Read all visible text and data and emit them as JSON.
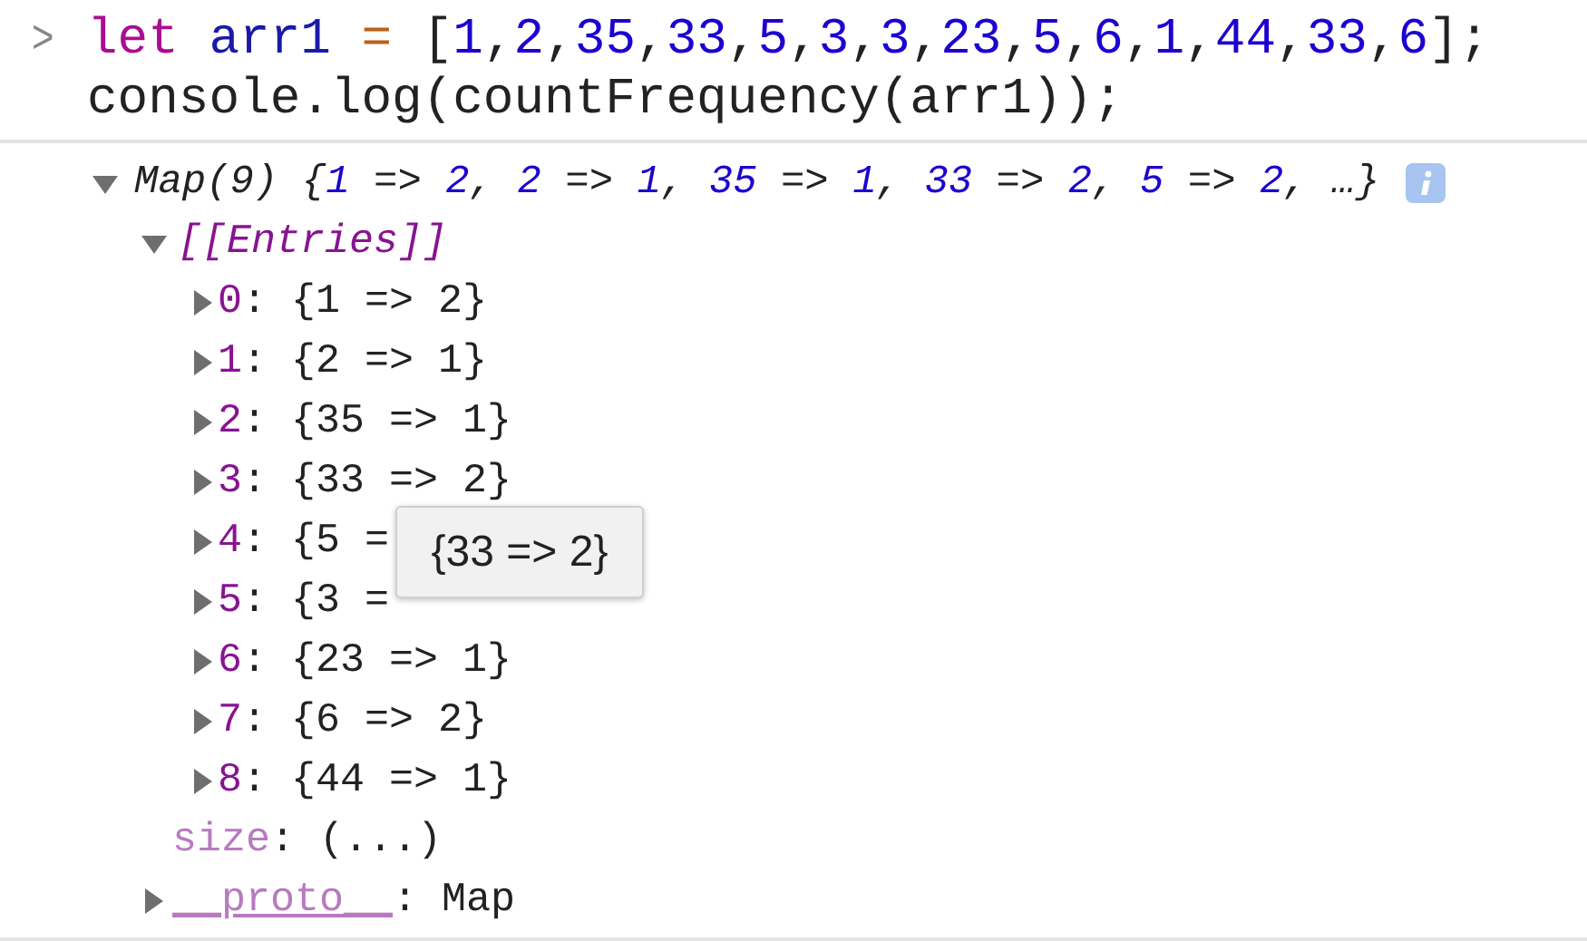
{
  "input": {
    "prompt": ">",
    "lines": [
      [
        {
          "text": "let ",
          "kind": "keyword"
        },
        {
          "text": "arr1 ",
          "kind": "variable"
        },
        {
          "text": "= ",
          "kind": "operator"
        },
        {
          "text": "[",
          "kind": "plain"
        },
        {
          "text": "1",
          "kind": "number"
        },
        {
          "text": ",",
          "kind": "plain"
        },
        {
          "text": "2",
          "kind": "number"
        },
        {
          "text": ",",
          "kind": "plain"
        },
        {
          "text": "35",
          "kind": "number"
        },
        {
          "text": ",",
          "kind": "plain"
        },
        {
          "text": "33",
          "kind": "number"
        },
        {
          "text": ",",
          "kind": "plain"
        },
        {
          "text": "5",
          "kind": "number"
        },
        {
          "text": ",",
          "kind": "plain"
        },
        {
          "text": "3",
          "kind": "number"
        },
        {
          "text": ",",
          "kind": "plain"
        },
        {
          "text": "3",
          "kind": "number"
        },
        {
          "text": ",",
          "kind": "plain"
        },
        {
          "text": "23",
          "kind": "number"
        },
        {
          "text": ",",
          "kind": "plain"
        },
        {
          "text": "5",
          "kind": "number"
        },
        {
          "text": ",",
          "kind": "plain"
        },
        {
          "text": "6",
          "kind": "number"
        },
        {
          "text": ",",
          "kind": "plain"
        },
        {
          "text": "1",
          "kind": "number"
        },
        {
          "text": ",",
          "kind": "plain"
        },
        {
          "text": "44",
          "kind": "number"
        },
        {
          "text": ",",
          "kind": "plain"
        },
        {
          "text": "33",
          "kind": "number"
        },
        {
          "text": ",",
          "kind": "plain"
        },
        {
          "text": "6",
          "kind": "number"
        },
        {
          "text": "];",
          "kind": "plain"
        }
      ],
      [
        {
          "text": "console.log(countFrequency(arr1));",
          "kind": "plain"
        }
      ]
    ]
  },
  "output": {
    "expanded": true,
    "preview": [
      {
        "text": "Map(9) ",
        "kind": "plain"
      },
      {
        "text": "{",
        "kind": "plain"
      },
      {
        "text": "1",
        "kind": "number"
      },
      {
        "text": " => ",
        "kind": "plain"
      },
      {
        "text": "2",
        "kind": "number"
      },
      {
        "text": ", ",
        "kind": "plain"
      },
      {
        "text": "2",
        "kind": "number"
      },
      {
        "text": " => ",
        "kind": "plain"
      },
      {
        "text": "1",
        "kind": "number"
      },
      {
        "text": ", ",
        "kind": "plain"
      },
      {
        "text": "35",
        "kind": "number"
      },
      {
        "text": " => ",
        "kind": "plain"
      },
      {
        "text": "1",
        "kind": "number"
      },
      {
        "text": ", ",
        "kind": "plain"
      },
      {
        "text": "33",
        "kind": "number"
      },
      {
        "text": " => ",
        "kind": "plain"
      },
      {
        "text": "2",
        "kind": "number"
      },
      {
        "text": ", ",
        "kind": "plain"
      },
      {
        "text": "5",
        "kind": "number"
      },
      {
        "text": " => ",
        "kind": "plain"
      },
      {
        "text": "2",
        "kind": "number"
      },
      {
        "text": ", …}",
        "kind": "plain"
      }
    ],
    "entries_group": {
      "label": "[[Entries]]",
      "expanded": true,
      "entries": [
        {
          "index": "0",
          "value": ": {1 => 2}",
          "expanded": false
        },
        {
          "index": "1",
          "value": ": {2 => 1}",
          "expanded": false
        },
        {
          "index": "2",
          "value": ": {35 => 1}",
          "expanded": false
        },
        {
          "index": "3",
          "value": ": {33 => 2}",
          "expanded": false
        },
        {
          "index": "4",
          "value": ": {5 =",
          "expanded": false
        },
        {
          "index": "5",
          "value": ": {3 =",
          "expanded": false
        },
        {
          "index": "6",
          "value": ": {23 => 1}",
          "expanded": false
        },
        {
          "index": "7",
          "value": ": {6 => 2}",
          "expanded": false
        },
        {
          "index": "8",
          "value": ": {44 => 1}",
          "expanded": false
        }
      ]
    },
    "size": {
      "key": "size",
      "value": ": (...)"
    },
    "proto": {
      "key": "__proto__",
      "value": ": Map",
      "expanded": false
    }
  },
  "tooltip": {
    "text": "{33 => 2}"
  }
}
